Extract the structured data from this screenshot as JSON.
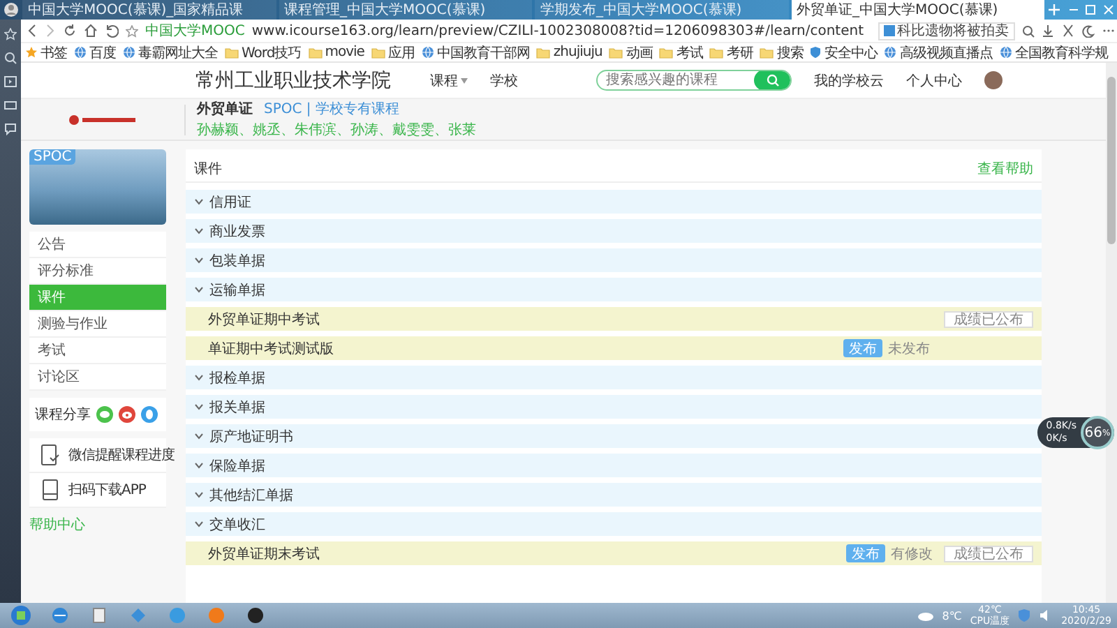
{
  "browser": {
    "tabs": [
      {
        "title": "中国大学MOOC(慕课)_国家精品课",
        "selected": false
      },
      {
        "title": "课程管理_中国大学MOOC(慕课)",
        "selected": false
      },
      {
        "title": "学期发布_中国大学MOOC(慕课)",
        "selected": false
      },
      {
        "title": "外贸单证_中国大学MOOC(慕课)",
        "selected": true
      }
    ],
    "site_badge": "中国大学MOOC",
    "url": "www.icourse163.org/learn/preview/CZILI-1002308008?tid=1206098303#/learn/content",
    "search_value": "科比遗物将被拍卖",
    "bookmarks": [
      {
        "label": "书签",
        "kind": "star"
      },
      {
        "label": "百度",
        "kind": "site"
      },
      {
        "label": "毒霸网址大全",
        "kind": "site"
      },
      {
        "label": "Word技巧",
        "kind": "folder"
      },
      {
        "label": "movie",
        "kind": "folder"
      },
      {
        "label": "应用",
        "kind": "folder"
      },
      {
        "label": "中国教育干部网",
        "kind": "site"
      },
      {
        "label": "zhujiuju",
        "kind": "folder"
      },
      {
        "label": "动画",
        "kind": "folder"
      },
      {
        "label": "考试",
        "kind": "folder"
      },
      {
        "label": "考研",
        "kind": "folder"
      },
      {
        "label": "搜索",
        "kind": "folder"
      },
      {
        "label": "安全中心",
        "kind": "shield"
      },
      {
        "label": "高级视频直播点",
        "kind": "site"
      },
      {
        "label": "全国教育科学规",
        "kind": "site"
      }
    ]
  },
  "header": {
    "school": "常州工业职业技术学院",
    "nav": [
      {
        "label": "课程",
        "dropdown": true
      },
      {
        "label": "学校",
        "dropdown": false
      }
    ],
    "search_placeholder": "搜索感兴趣的课程",
    "links": [
      "我的学校云",
      "个人中心"
    ]
  },
  "course": {
    "title": "外贸单证",
    "type": "SPOC | 学校专有课程",
    "teachers": "孙赫颖、姚丞、朱伟滨、孙涛、戴雯雯、张莱",
    "image_badge": "SPOC"
  },
  "sidebar": {
    "items": [
      {
        "label": "公告",
        "selected": false
      },
      {
        "label": "评分标准",
        "selected": false
      },
      {
        "label": "课件",
        "selected": true
      },
      {
        "label": "测验与作业",
        "selected": false
      },
      {
        "label": "考试",
        "selected": false
      },
      {
        "label": "讨论区",
        "selected": false
      }
    ],
    "share_label": "课程分享",
    "app_items": [
      {
        "label": "微信提醒课程进度",
        "kind": "wechat"
      },
      {
        "label": "扫码下载APP",
        "kind": "phone"
      }
    ],
    "help": "帮助中心"
  },
  "content": {
    "title": "课件",
    "help_link": "查看帮助",
    "items": [
      {
        "kind": "chapter",
        "label": "信用证"
      },
      {
        "kind": "chapter",
        "label": "商业发票"
      },
      {
        "kind": "chapter",
        "label": "包装单据"
      },
      {
        "kind": "chapter",
        "label": "运输单据",
        "children": [
          {
            "kind": "exam",
            "label": "外贸单证期中考试",
            "badge": "成绩已公布"
          },
          {
            "kind": "exam",
            "label": "单证期中考试测试版",
            "button": "发布",
            "status": "未发布"
          }
        ]
      },
      {
        "kind": "chapter",
        "label": "报检单据"
      },
      {
        "kind": "chapter",
        "label": "报关单据"
      },
      {
        "kind": "chapter",
        "label": "原产地证明书"
      },
      {
        "kind": "chapter",
        "label": "保险单据"
      },
      {
        "kind": "chapter",
        "label": "其他结汇单据"
      },
      {
        "kind": "chapter",
        "label": "交单收汇",
        "children": [
          {
            "kind": "exam",
            "label": "外贸单证期末考试",
            "button": "发布",
            "status": "有修改",
            "badge": "成绩已公布"
          }
        ]
      }
    ]
  },
  "speed_widget": {
    "upload": "0.8K/s",
    "download": "0K/s",
    "value": "66",
    "unit": "%"
  },
  "taskbar": {
    "weather": "8℃",
    "cpu_temp": "42℃",
    "cpu_label": "CPU温度",
    "time": "10:45",
    "date": "2020/2/29"
  }
}
